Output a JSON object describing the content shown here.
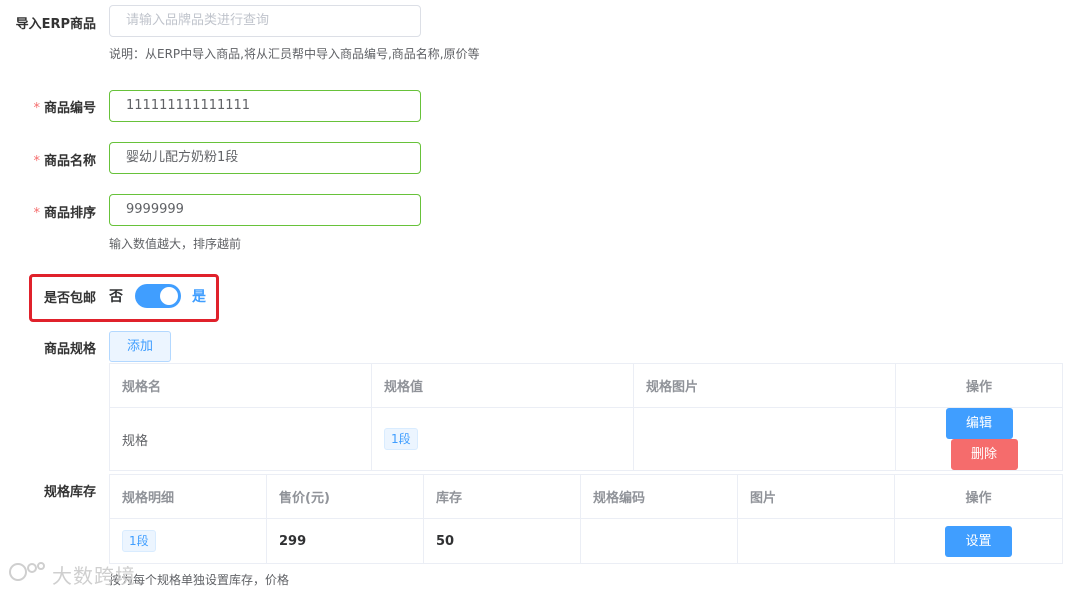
{
  "erp": {
    "label": "导入ERP商品",
    "placeholder": "请输入品牌品类进行查询",
    "tip": "说明：从ERP中导入商品,将从汇员帮中导入商品编号,商品名称,原价等"
  },
  "code": {
    "label": "商品编号",
    "value": "111111111111111"
  },
  "name": {
    "label": "商品名称",
    "value": "婴幼儿配方奶粉1段"
  },
  "sort": {
    "label": "商品排序",
    "value": "9999999",
    "tip": "输入数值越大，排序越前"
  },
  "shipping": {
    "label": "是否包邮",
    "off_text": "否",
    "on_text": "是",
    "on": true
  },
  "specs": {
    "label": "商品规格",
    "add_label": "添加",
    "headers": [
      "规格名",
      "规格值",
      "规格图片",
      "操作"
    ],
    "rows": [
      {
        "name": "规格",
        "value": "1段",
        "image": "",
        "edit": "编辑",
        "delete": "删除"
      }
    ]
  },
  "stock": {
    "label": "规格库存",
    "headers": [
      "规格明细",
      "售价(元)",
      "库存",
      "规格编码",
      "图片",
      "操作"
    ],
    "rows": [
      {
        "detail": "1段",
        "price": "299",
        "stock": "50",
        "code": "",
        "image": "",
        "action": "设置"
      }
    ],
    "tip_visible": "按为每个规格单独设置库存，价格"
  },
  "watermark": "大数跨境",
  "colors": {
    "primary": "#409eff",
    "danger": "#f56c6c",
    "success": "#67c23a",
    "highlight": "#e0212b"
  }
}
